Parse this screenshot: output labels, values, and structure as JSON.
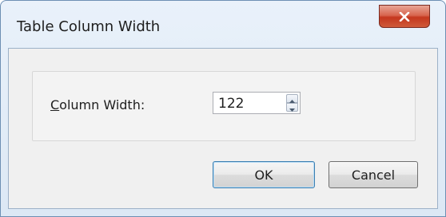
{
  "dialog": {
    "title": "Table Column Width",
    "close_icon": "close-icon"
  },
  "field": {
    "label_first": "C",
    "label_rest": "olumn Width:",
    "value": "122",
    "spinner_icons": [
      "chevron-up-icon",
      "chevron-down-icon"
    ]
  },
  "buttons": {
    "ok": "OK",
    "cancel": "Cancel"
  },
  "colors": {
    "close_button": "#c4371e",
    "client_background": "#f0f0f0",
    "default_button_border": "#3c7fb1"
  }
}
